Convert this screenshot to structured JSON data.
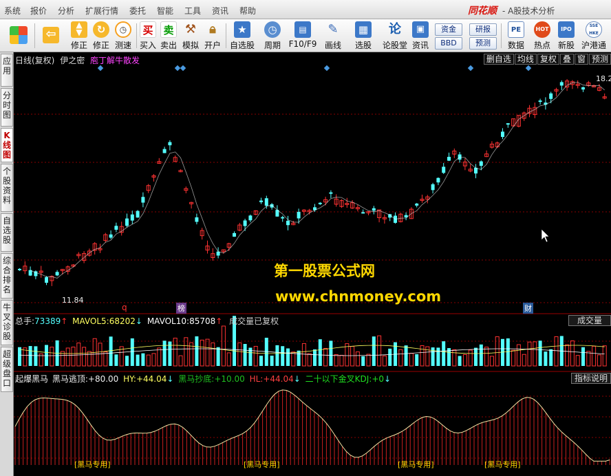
{
  "menubar": {
    "items": [
      "系统",
      "报价",
      "分析",
      "扩展行情",
      "委托",
      "智能",
      "工具",
      "资讯",
      "帮助"
    ],
    "brand": "同花顺",
    "app_title": "- A股技术分析"
  },
  "toolbar": {
    "buttons": [
      {
        "label": "",
        "icon": "back-arrow-icon"
      },
      {
        "label": "修正",
        "icon": "up-down-arrows-icon"
      },
      {
        "label": "修正",
        "icon": "refresh-circle-icon"
      },
      {
        "label": "测速",
        "icon": "clock-icon"
      },
      {
        "label": "买入",
        "icon": "buy-icon",
        "glyph": "买"
      },
      {
        "label": "卖出",
        "icon": "sell-icon",
        "glyph": "卖"
      },
      {
        "label": "模拟",
        "icon": "hammer-icon"
      },
      {
        "label": "开户",
        "icon": "lock-icon"
      },
      {
        "label": "自选股",
        "icon": "star-folder-icon"
      },
      {
        "label": "周期",
        "icon": "cycle-clock-icon"
      },
      {
        "label": "F10/F9",
        "icon": "f10-icon"
      },
      {
        "label": "画线",
        "icon": "pencil-icon"
      },
      {
        "label": "选股",
        "icon": "screen-icon"
      },
      {
        "label": "论股堂",
        "icon": "lun-icon",
        "glyph": "论"
      },
      {
        "label": "资讯",
        "icon": "info-icon"
      },
      {
        "label": "数据",
        "icon": "pe-icon",
        "glyph": "PE"
      },
      {
        "label": "热点",
        "icon": "hot-icon",
        "glyph": "HOT"
      },
      {
        "label": "新股",
        "icon": "ipo-icon",
        "glyph": "IPO"
      },
      {
        "label": "沪港通",
        "icon": "hk-connect-icon",
        "glyph": "SSE HKE"
      }
    ],
    "small_buttons": [
      "资金",
      "BBD",
      "研报",
      "预测"
    ]
  },
  "lefttabs": [
    "应用",
    "分时图",
    "K线图",
    "个股资料",
    "自选股",
    "综合排名",
    "牛叉诊股",
    "超级盘口"
  ],
  "chart": {
    "header_left": "日线(复权)",
    "stock_name": "伊之密",
    "concept": "庖丁解牛散发",
    "right_buttons": [
      "删自选",
      "均线",
      "复权",
      "叠",
      "窗",
      "预测"
    ],
    "price_high": "18.2",
    "price_low": "11.84",
    "markers": [
      "q",
      "榜",
      "财"
    ],
    "watermark_title": "第一股票公式网",
    "watermark_url": "www.chnmoney.com",
    "colors": {
      "up": "#ff3232",
      "down": "#54ffff",
      "ma": "#ffffff",
      "grid": "#8b0000"
    }
  },
  "volume": {
    "total_label": "总手:",
    "total_value": "73389",
    "mavol5_label": "MAVOL5:",
    "mavol5_value": "68202",
    "mavol10_label": "MAVOL10:",
    "mavol10_value": "85708",
    "adjusted_note": "成交量已复权",
    "panel_label": "成交量"
  },
  "indicator": {
    "name": "起爆黑马",
    "items": [
      {
        "label": "黑马逃顶:",
        "value": "+80.00"
      },
      {
        "label": "HY:",
        "value": "+44.04"
      },
      {
        "label": "黑马抄底:",
        "value": "+10.00"
      },
      {
        "label": "HL:",
        "value": "+44.04"
      },
      {
        "label": "二十以下金叉KDJ:",
        "value": "+0"
      }
    ],
    "panel_label": "指标说明",
    "tag": "[黑马专用]"
  }
}
